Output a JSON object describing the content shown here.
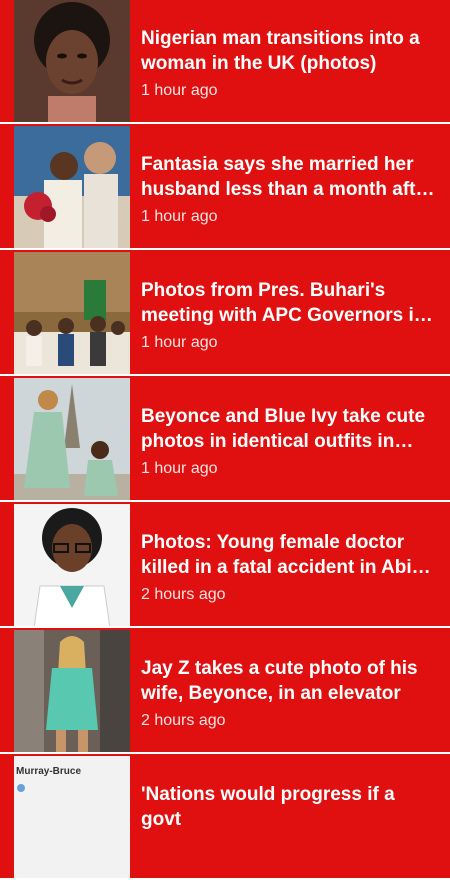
{
  "feed": {
    "items": [
      {
        "title": "Nigerian man transitions into a woman in the UK (photos)",
        "time": "1 hour ago",
        "thumb_icon": "portrait-photo"
      },
      {
        "title": "Fantasia says she married her husband less than a month after the...",
        "time": "1 hour ago",
        "thumb_icon": "couple-photo"
      },
      {
        "title": "Photos from Pres. Buhari's meeting with APC Governors in Aso Rock",
        "time": "1 hour ago",
        "thumb_icon": "meeting-photo"
      },
      {
        "title": "Beyonce and Blue Ivy take cute photos in identical outfits in Paris",
        "time": "1 hour ago",
        "thumb_icon": "paris-photo"
      },
      {
        "title": "Photos: Young female doctor killed in a fatal accident in Abia Sate",
        "time": "2 hours ago",
        "thumb_icon": "doctor-photo"
      },
      {
        "title": "Jay Z takes a cute photo of his wife, Beyonce, in an elevator",
        "time": "2 hours ago",
        "thumb_icon": "elevator-photo"
      },
      {
        "title": "'Nations would progress if a govt",
        "time": "",
        "thumb_icon": "tweet-photo",
        "thumb_caption": "Murray-Bruce"
      }
    ]
  }
}
